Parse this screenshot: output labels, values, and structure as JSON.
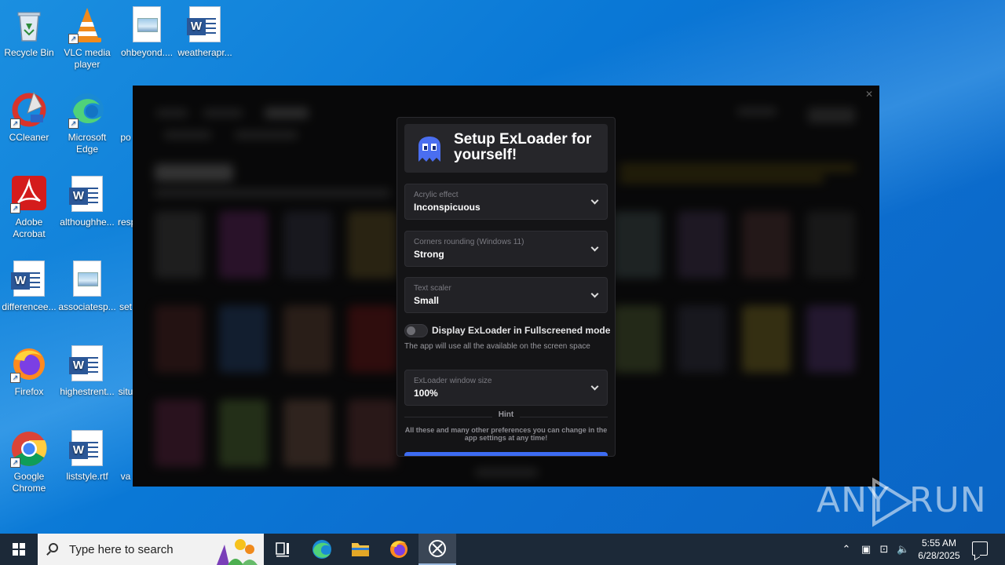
{
  "desktop": {
    "icons": [
      {
        "label": "Recycle Bin"
      },
      {
        "label": "VLC media player"
      },
      {
        "label": "ohbeyond...."
      },
      {
        "label": "weatherapr..."
      },
      {
        "label": "CCleaner"
      },
      {
        "label": "Microsoft Edge"
      },
      {
        "label": "po"
      },
      {
        "label": "Adobe Acrobat"
      },
      {
        "label": "althoughhe..."
      },
      {
        "label": "resp"
      },
      {
        "label": "differencee..."
      },
      {
        "label": "associatesp..."
      },
      {
        "label": "set"
      },
      {
        "label": "Firefox"
      },
      {
        "label": "highestrent..."
      },
      {
        "label": "situ"
      },
      {
        "label": "Google Chrome"
      },
      {
        "label": "liststyle.rtf"
      },
      {
        "label": "va"
      }
    ]
  },
  "dialog": {
    "title": "Setup ExLoader for yourself!",
    "acrylic": {
      "label": "Acrylic effect",
      "value": "Inconspicuous"
    },
    "corners": {
      "label": "Corners rounding (Windows 11)",
      "value": "Strong"
    },
    "text_scaler": {
      "label": "Text scaler",
      "value": "Small"
    },
    "fullscreen": {
      "label": "Display ExLoader in Fullscreened mode",
      "description": "The app will use all the available on the screen space",
      "enabled": false
    },
    "window_size": {
      "label": "ExLoader window size",
      "value": "100%"
    },
    "hint": {
      "title": "Hint",
      "text": "All these and many other preferences you can change in the app settings at any time!"
    }
  },
  "watermark": {
    "left": "ANY",
    "right": "RUN"
  },
  "taskbar": {
    "search_placeholder": "Type here to search",
    "time": "5:55 AM",
    "date": "6/28/2025"
  },
  "colors": {
    "accent": "#3d6cf2",
    "dialog_bg": "#141416",
    "taskbar": "#1c2938"
  }
}
